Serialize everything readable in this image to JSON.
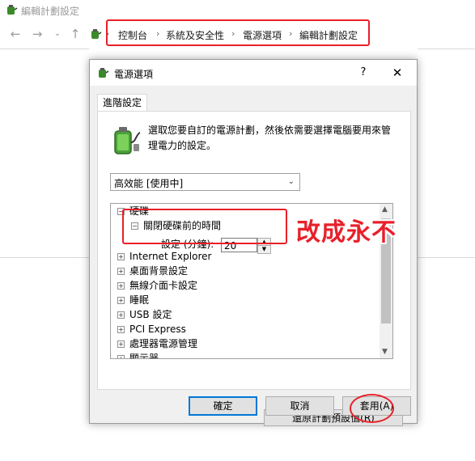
{
  "window": {
    "title": "編輯計劃設定",
    "breadcrumb": [
      "控制台",
      "系統及安全性",
      "電源選項",
      "編輯計劃設定"
    ]
  },
  "dialog": {
    "title": "電源選項",
    "help": "?",
    "close": "✕",
    "tab": "進階設定",
    "description": "選取您要自訂的電源計劃，然後依需要選擇電腦要用來管理電力的設定。",
    "plan_selected": "高效能 [使用中]",
    "tree": {
      "root": "硬碟",
      "child": "關閉硬碟前的時間",
      "setting_label": "設定 (分鐘):",
      "setting_value": "20",
      "items": [
        "Internet Explorer",
        "桌面背景設定",
        "無線介面卡設定",
        "睡眠",
        "USB 設定",
        "PCI Express",
        "處理器電源管理",
        "顯示器"
      ]
    },
    "restore_button": "還原計劃預設值(R)",
    "ok_button": "確定",
    "cancel_button": "取消",
    "apply_button": "套用(A)"
  },
  "annotation": "改成永不",
  "colors": {
    "highlight": "#e8202a",
    "focus": "#0078d7"
  },
  "icons": {
    "battery": "green-battery-plug-icon"
  }
}
